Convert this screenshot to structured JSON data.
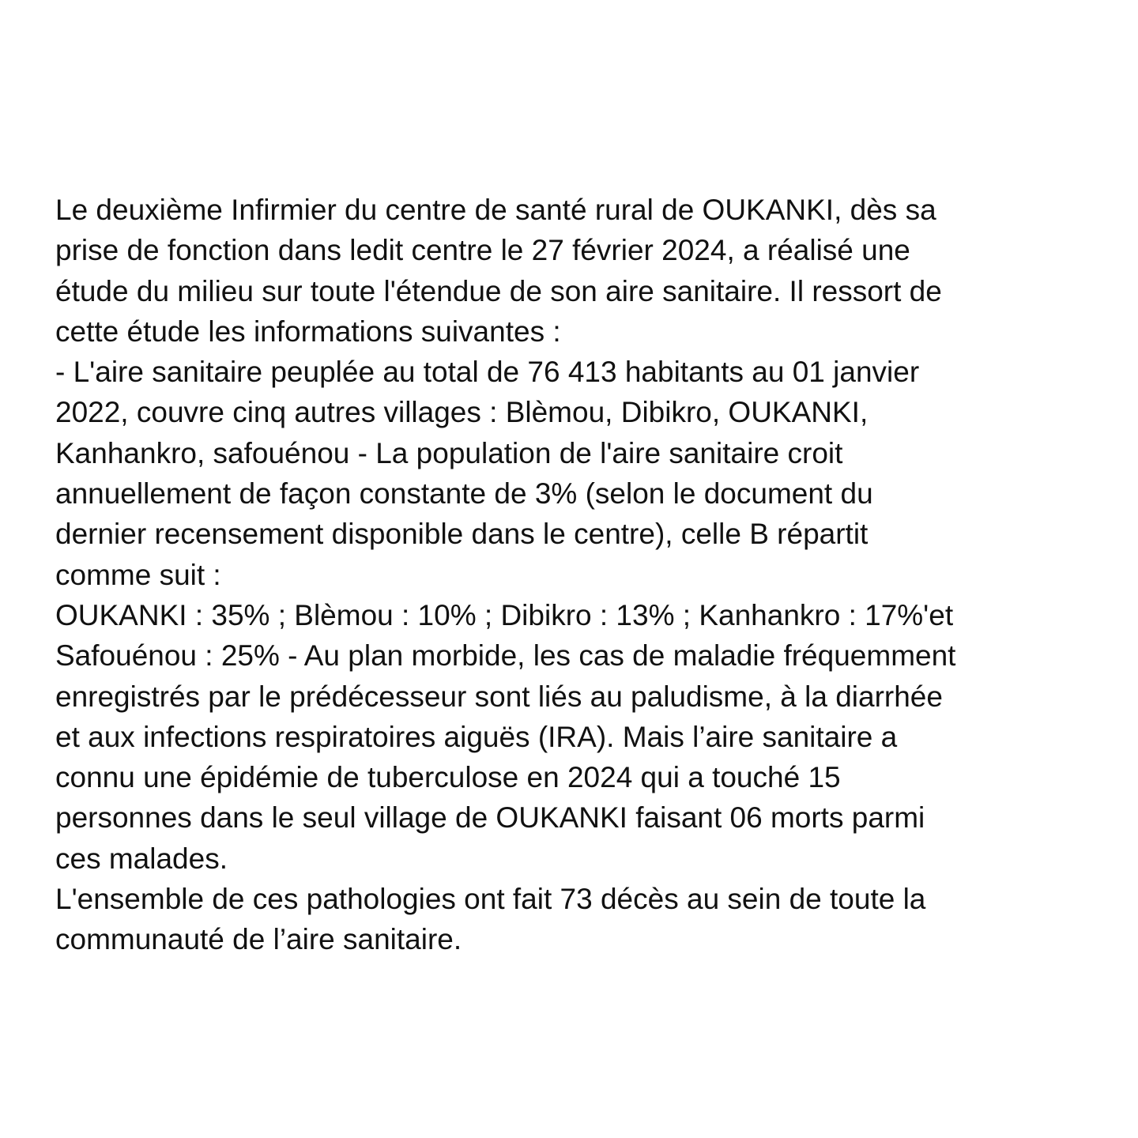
{
  "document": {
    "lines": [
      "Le deuxième Infirmier du centre de santé rural de OUKANKI, dès sa",
      "prise de fonction dans ledit centre le 27 février 2024, a réalisé une",
      "étude du milieu sur toute l'étendue de son aire sanitaire. Il ressort de",
      "cette étude les informations suivantes :",
      "- L'aire sanitaire peuplée au total de 76 413 habitants au 01 janvier",
      "2022, couvre cinq autres villages : Blèmou, Dibikro, OUKANKI,",
      "Kanhankro, safouénou - La population de l'aire sanitaire croit",
      "annuellement de façon constante de 3% (selon le document du",
      "dernier recensement disponible dans le centre), celle B répartit",
      "comme suit :",
      "OUKANKI : 35% ; Blèmou : 10% ; Dibikro : 13% ; Kanhankro : 17%'et",
      "Safouénou : 25% - Au plan morbide, les cas de maladie fréquemment",
      "enregistrés par le prédécesseur sont liés au paludisme, à la diarrhée",
      "et aux infections respiratoires aiguës (IRA). Mais l’aire sanitaire a",
      "connu une épidémie de tuberculose en 2024 qui a touché 15",
      "personnes dans le seul village de OUKANKI faisant 06 morts parmi",
      "ces malades.",
      "L'ensemble de ces pathologies ont fait 73 décès au sein de toute la",
      "communauté de l’aire sanitaire."
    ]
  }
}
